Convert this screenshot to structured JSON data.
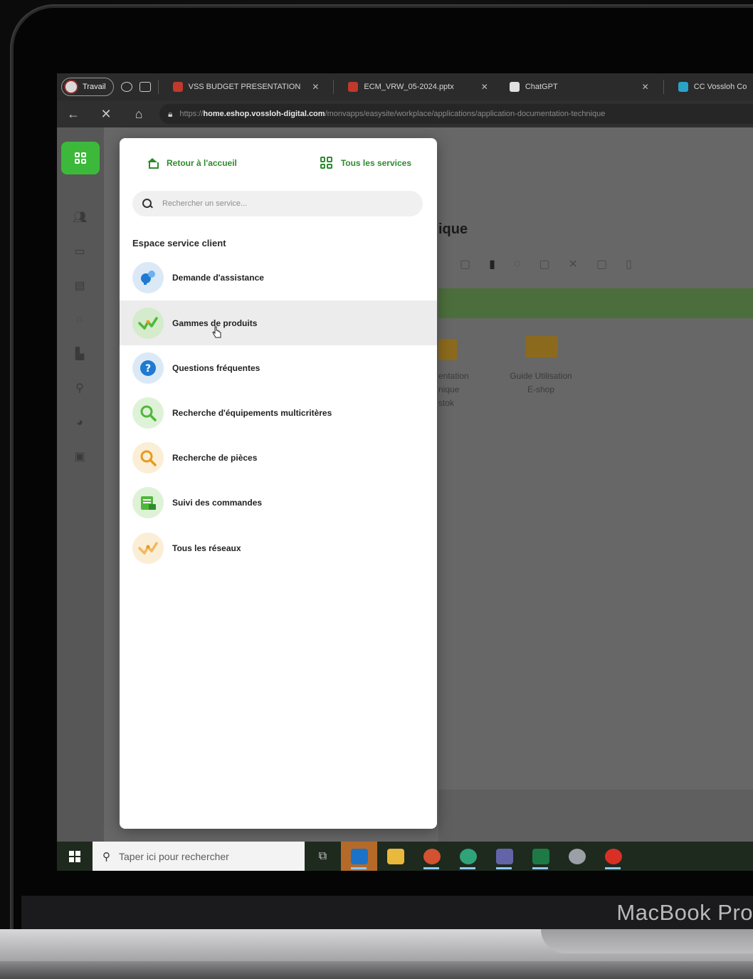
{
  "device": {
    "brand_label": "MacBook Pro"
  },
  "browser": {
    "profile": {
      "label": "Travail"
    },
    "tabs": [
      {
        "label": "VSS BUDGET PRESENTATION",
        "favicon_color": "#c0392b"
      },
      {
        "label": "ECM_VRW_05-2024.pptx",
        "favicon_color": "#c0392b"
      },
      {
        "label": "ChatGPT",
        "favicon_color": "#e0e0e0"
      },
      {
        "label": "CC Vossloh Co",
        "favicon_color": "#2aa3c9"
      }
    ],
    "url": {
      "protocol": "https://",
      "host": "home.eshop.vossloh-digital.com",
      "path": "/monvapps/easysite/workplace/applications/application-documentation-technique"
    }
  },
  "background_page": {
    "title_fragment": "ique",
    "folders": [
      {
        "label_lines": [
          "entation",
          "nique",
          "stok"
        ]
      },
      {
        "label_lines": [
          "Guide Utilisation",
          "E-shop"
        ]
      }
    ]
  },
  "panel": {
    "home_link": "Retour à l'accueil",
    "all_services_link": "Tous les services",
    "search_placeholder": "Rechercher un service...",
    "section_title": "Espace service client",
    "items": [
      {
        "label": "Demande d'assistance",
        "icon": "support-icon",
        "icon_bg": "#dbe9f7",
        "icon_color": "#1f7ad1"
      },
      {
        "label": "Gammes de produits",
        "icon": "products-icon",
        "icon_bg": "#def2d8",
        "icon_color": "#4fb83a"
      },
      {
        "label": "Questions fréquentes",
        "icon": "help-icon",
        "icon_bg": "#dbe9f7",
        "icon_color": "#1f7ad1"
      },
      {
        "label": "Recherche d'équipements multicritères",
        "icon": "search-equipment-icon",
        "icon_bg": "#def2d8",
        "icon_color": "#4fb83a"
      },
      {
        "label": "Recherche de pièces",
        "icon": "search-parts-icon",
        "icon_bg": "#fbeed6",
        "icon_color": "#e89a1c"
      },
      {
        "label": "Suivi des commandes",
        "icon": "orders-icon",
        "icon_bg": "#def2d8",
        "icon_color": "#4fb83a"
      },
      {
        "label": "Tous les réseaux",
        "icon": "networks-icon",
        "icon_bg": "#fbeed6",
        "icon_color": "#e89a1c"
      }
    ],
    "hovered_item": "Gammes de produits"
  },
  "taskbar": {
    "search_placeholder": "Taper ici pour rechercher",
    "apps": [
      {
        "name": "outlook-icon",
        "color": "#1a73c8"
      },
      {
        "name": "file-explorer-icon",
        "color": "#e8b93a"
      },
      {
        "name": "powerpoint-icon",
        "color": "#d35230"
      },
      {
        "name": "edge-icon",
        "color": "#2fa37a"
      },
      {
        "name": "teams-icon",
        "color": "#6264a7"
      },
      {
        "name": "excel-icon",
        "color": "#1d7a45"
      },
      {
        "name": "app-icon",
        "color": "#9aa0a6"
      },
      {
        "name": "chrome-icon",
        "color": "#d93025"
      }
    ]
  },
  "colors": {
    "accent_green": "#3cb93a",
    "link_green": "#2e8b2e"
  }
}
